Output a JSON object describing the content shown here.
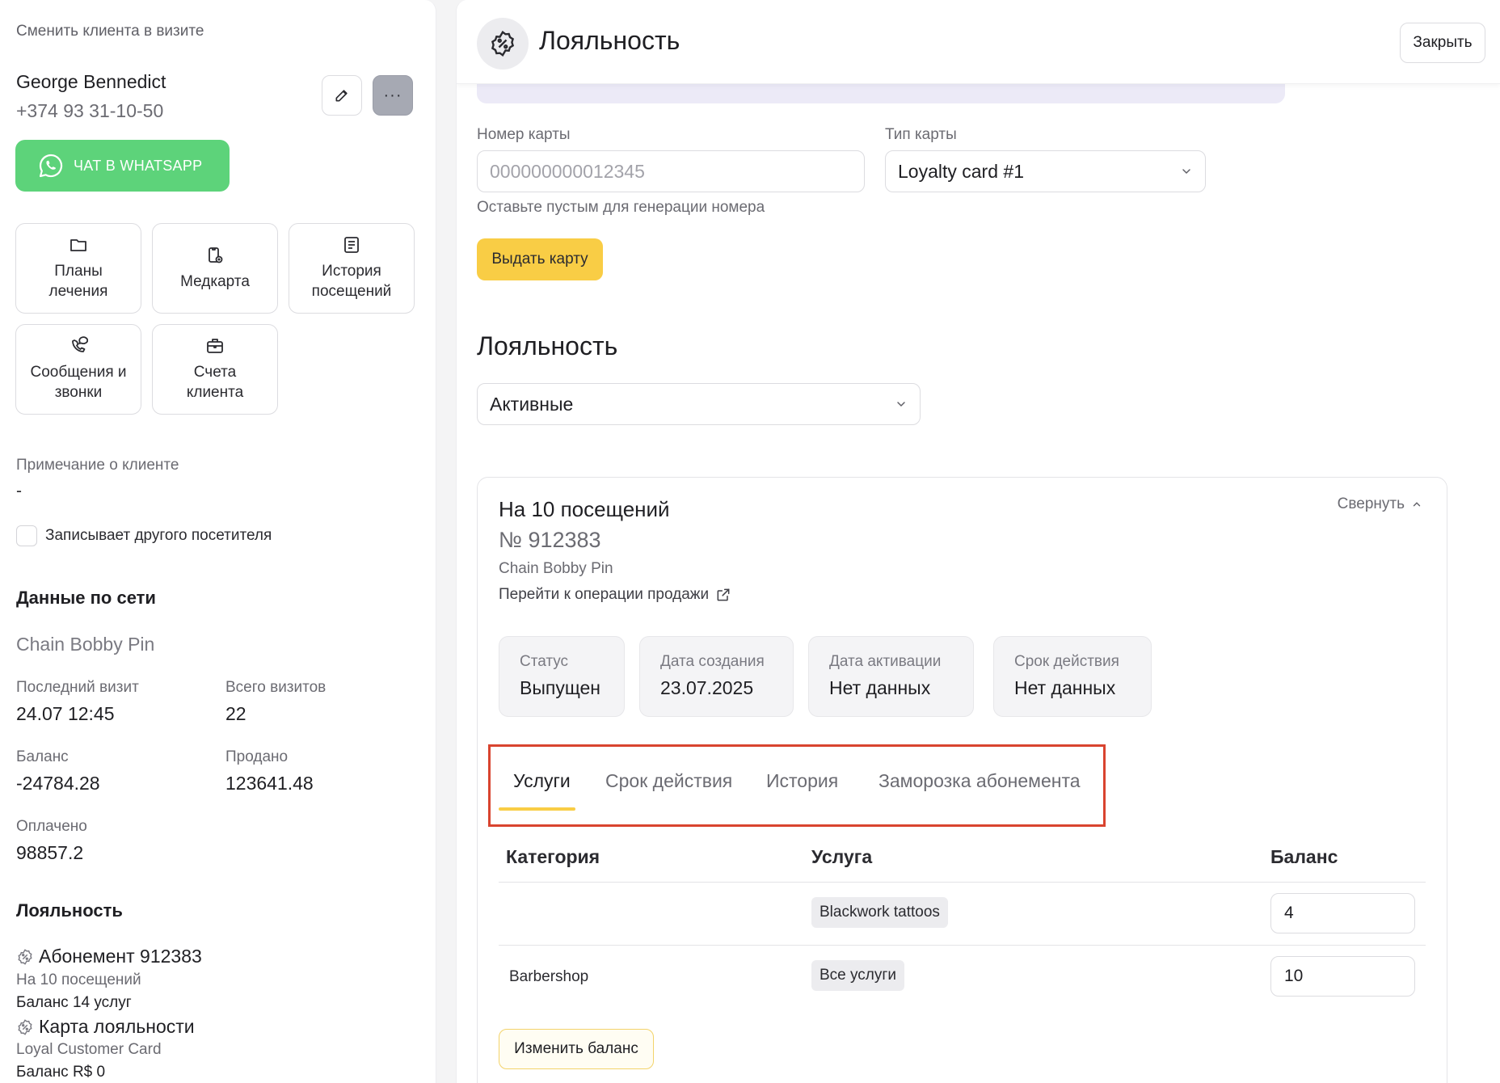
{
  "left": {
    "switch_client": "Сменить клиента в визите",
    "client_name": "George Bennedict",
    "client_phone": "+374 93 31-10-50",
    "more_label": "···",
    "whatsapp_label": "ЧАТ В WHATSAPP",
    "tiles": [
      {
        "label": "Планы лечения",
        "icon": "folder-icon"
      },
      {
        "label": "Медкарта",
        "icon": "medcard-icon"
      },
      {
        "label": "История посещений",
        "icon": "history-icon"
      },
      {
        "label": "Сообщения и звонки",
        "icon": "phone-chat-icon"
      },
      {
        "label": "Счета клиента",
        "icon": "briefcase-icon"
      }
    ],
    "note_label": "Примечание о клиенте",
    "note_value": "-",
    "other_visitor_label": "Записывает другого посетителя",
    "network_heading": "Данные по сети",
    "network_name": "Chain Bobby Pin",
    "stats": {
      "last_visit_label": "Последний визит",
      "last_visit_value": "24.07 12:45",
      "total_visits_label": "Всего визитов",
      "total_visits_value": "22",
      "balance_label": "Баланс",
      "balance_value": "-24784.28",
      "sold_label": "Продано",
      "sold_value": "123641.48",
      "paid_label": "Оплачено",
      "paid_value": "98857.2"
    },
    "loyalty_heading": "Лояльность",
    "loyalty_items": [
      {
        "title": "Абонемент 912383",
        "subtitle": "На 10 посещений",
        "balance": "Баланс 14 услуг"
      },
      {
        "title": "Карта лояльности",
        "subtitle": "Loyal Customer Card",
        "balance": "Баланс R$ 0"
      }
    ]
  },
  "right": {
    "title": "Лояльность",
    "close_label": "Закрыть",
    "card_number_label": "Номер карты",
    "card_number_placeholder": "000000000012345",
    "card_type_label": "Тип карты",
    "card_type_value": "Loyalty card #1",
    "card_number_hint": "Оставьте пустым для генерации номера",
    "issue_card_label": "Выдать карту",
    "loyalty_heading": "Лояльность",
    "status_filter_value": "Активные",
    "subscription": {
      "title": "На 10 посещений",
      "collapse_label": "Свернуть",
      "number": "№ 912383",
      "network": "Chain Bobby Pin",
      "sale_link": "Перейти к операции продажи",
      "info": [
        {
          "label": "Статус",
          "value": "Выпущен"
        },
        {
          "label": "Дата создания",
          "value": "23.07.2025"
        },
        {
          "label": "Дата активации",
          "value": "Нет данных"
        },
        {
          "label": "Срок действия",
          "value": "Нет данных"
        }
      ],
      "tabs": [
        "Услуги",
        "Срок действия",
        "История",
        "Заморозка абонемента"
      ],
      "active_tab": "Услуги",
      "table": {
        "headers": [
          "Категория",
          "Услуга",
          "Баланс"
        ],
        "rows": [
          {
            "category": "",
            "service": "Blackwork tattoos",
            "balance": "4"
          },
          {
            "category": "Barbershop",
            "service": "Все услуги",
            "balance": "10"
          }
        ]
      },
      "change_balance_label": "Изменить баланс"
    }
  },
  "colors": {
    "whatsapp": "#5dd37a",
    "accent_yellow": "#f9cd45",
    "highlight_frame": "#d9442f"
  }
}
